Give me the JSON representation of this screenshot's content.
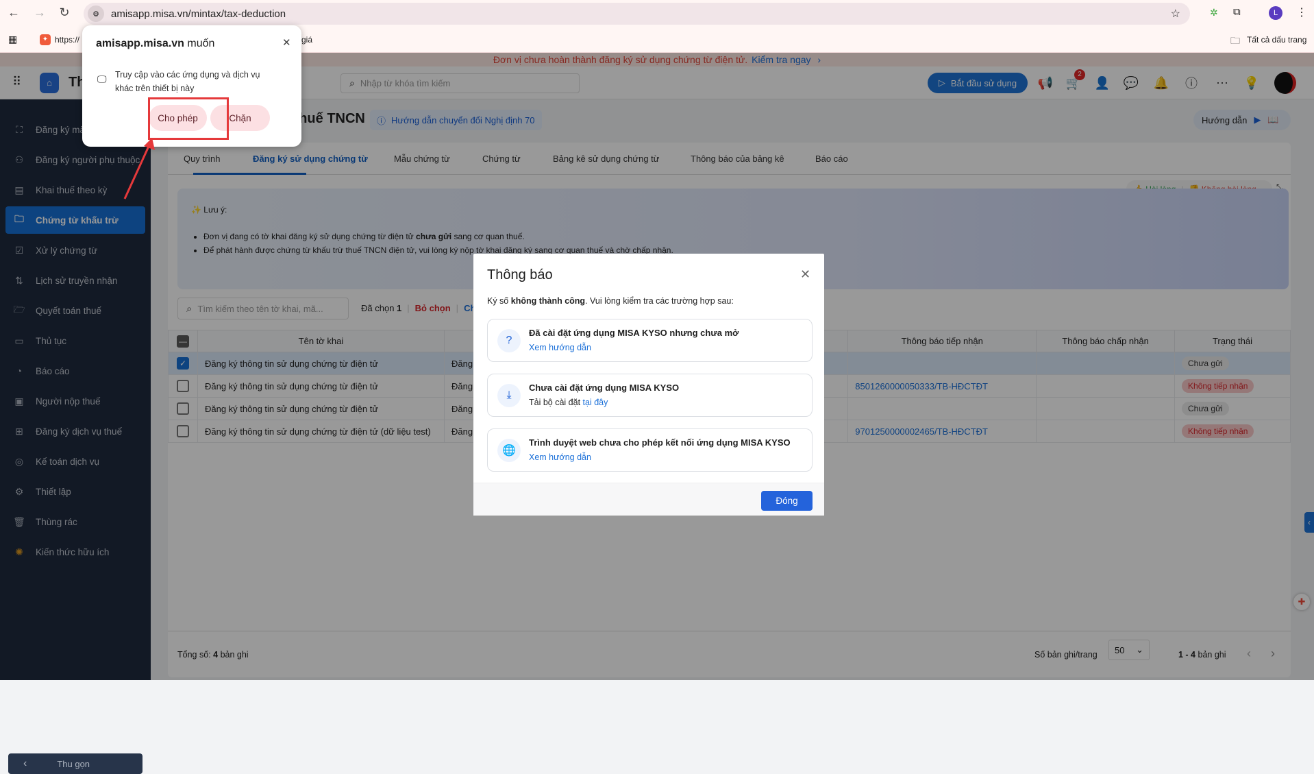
{
  "browser": {
    "url": "amisapp.misa.vn/mintax/tax-deduction",
    "profile_initial": "L",
    "bookmarks": [
      {
        "label": "https://"
      },
      {
        "label": "giá"
      }
    ],
    "all_bookmarks": "Tất cả dấu trang"
  },
  "permission_popup": {
    "title_site": "amisapp.misa.vn",
    "title_suffix": " muốn",
    "description": "Truy cập vào các ứng dụng và dịch vụ khác trên thiết bị này",
    "allow": "Cho phép",
    "block": "Chặn"
  },
  "banner": {
    "message": "Đơn vị chưa hoàn thành đăng ký sử dụng chứng từ điện tử.",
    "action": "Kiểm tra ngay"
  },
  "header": {
    "app_name": "Th",
    "search_placeholder": "Nhập từ khóa tìm kiếm",
    "start_button": "Bắt đầu sử dụng",
    "cart_badge": "2"
  },
  "sidebar": {
    "items": [
      {
        "label": "Đăng ký mã",
        "icon": "face-scan-icon"
      },
      {
        "label": "Đăng ký người phụ thuộc",
        "icon": "users-icon"
      },
      {
        "label": "Khai thuế theo kỳ",
        "icon": "document-icon"
      },
      {
        "label": "Chứng từ khấu trừ",
        "icon": "folder-icon",
        "active": true
      },
      {
        "label": "Xử lý chứng từ",
        "icon": "file-check-icon"
      },
      {
        "label": "Lịch sử truyền nhận",
        "icon": "transfer-icon"
      },
      {
        "label": "Quyết toán thuế",
        "icon": "folder-check-icon"
      },
      {
        "label": "Thủ tục",
        "icon": "card-icon"
      },
      {
        "label": "Báo cáo",
        "icon": "pie-chart-icon"
      },
      {
        "label": "Người nộp thuế",
        "icon": "user-box-icon"
      },
      {
        "label": "Đăng ký dịch vụ thuế",
        "icon": "add-service-icon"
      },
      {
        "label": "Kế toán dịch vụ",
        "icon": "accounting-icon"
      },
      {
        "label": "Thiết lập",
        "icon": "gear-icon"
      },
      {
        "label": "Thùng rác",
        "icon": "trash-icon"
      },
      {
        "label": "Kiến thức hữu ích",
        "icon": "knowledge-icon"
      }
    ],
    "collapse": "Thu gọn"
  },
  "page": {
    "title": "Chứng từ khấu trừ thuế TNCN",
    "guide_link": "Hướng dẫn chuyển đổi Nghị định 70",
    "guide_pill": "Hướng dẫn",
    "tabs": [
      "Quy trình",
      "Đăng ký sử dụng chứng từ",
      "Mẫu chứng từ",
      "Chứng từ",
      "Bảng kê sử dụng chứng từ",
      "Thông báo của bảng kê",
      "Báo cáo"
    ],
    "feedback": {
      "like": "Hài lòng",
      "dislike": "Không hài lòng"
    },
    "notice": {
      "title": "Lưu ý:",
      "line1_pre": "Đơn vị đang có tờ khai đăng ký sử dụng chứng từ điện tử ",
      "line1_bold": "chưa gửi",
      "line1_post": " sang cơ quan thuế.",
      "line2": "Để phát hành được chứng từ khấu trừ thuế TNCN điện tử, vui lòng ký nộp tờ khai đăng ký sang cơ quan thuế và chờ chấp nhận."
    },
    "toolbar": {
      "search_placeholder": "Tìm kiếm theo tên tờ khai, mã...",
      "selected_label": "Đã chọn",
      "selected_count": "1",
      "deselect": "Bỏ chọn",
      "more": "Chọ"
    },
    "table": {
      "headers": [
        "Tên tờ khai",
        "",
        "Thông báo tiếp nhận",
        "Thông báo chấp nhận",
        "Trạng thái"
      ],
      "rows": [
        {
          "name": "Đăng ký thông tin sử dụng chứng từ điện tử",
          "type": "Đăng",
          "receipt": "",
          "accept": "",
          "status": "Chưa gửi",
          "status_kind": "gray",
          "checked": true
        },
        {
          "name": "Đăng ký thông tin sử dụng chứng từ điện tử",
          "type": "Đăng",
          "receipt": "8501260000050333/TB-HĐCTĐT",
          "accept": "",
          "status": "Không tiếp nhận",
          "status_kind": "red",
          "checked": false
        },
        {
          "name": "Đăng ký thông tin sử dụng chứng từ điện tử",
          "type": "Đăng",
          "receipt": "",
          "accept": "",
          "status": "Chưa gửi",
          "status_kind": "gray",
          "checked": false
        },
        {
          "name": "Đăng ký thông tin sử dụng chứng từ điện tử (dữ liệu test)",
          "type": "Đăng",
          "receipt": "9701250000002465/TB-HĐCTĐT",
          "accept": "",
          "status": "Không tiếp nhận",
          "status_kind": "red",
          "checked": false
        }
      ]
    },
    "footer": {
      "total_label": "Tổng số:",
      "total_count": "4",
      "total_unit": "bản ghi",
      "per_page_label": "Số bản ghi/trang",
      "per_page": "50",
      "range_bold": "1 - 4",
      "range_unit": "bản ghi"
    }
  },
  "modal": {
    "title": "Thông báo",
    "intro_pre": "Ký số ",
    "intro_bold": "không thành công",
    "intro_post": ". Vui lòng kiểm tra các trường hợp sau:",
    "cases": [
      {
        "title": "Đã cài đặt ứng dụng MISA KYSO nhưng chưa mở",
        "text": "",
        "link": "Xem hướng dẫn",
        "icon": "question-icon"
      },
      {
        "title": "Chưa cài đặt ứng dụng MISA KYSO",
        "text": "Tải bộ cài đặt ",
        "link": "tại đây",
        "icon": "download-icon"
      },
      {
        "title": "Trình duyệt web chưa cho phép kết nối ứng dụng MISA KYSO",
        "text": "",
        "link": "Xem hướng dẫn",
        "icon": "globe-icon"
      }
    ],
    "close_button": "Đóng"
  }
}
